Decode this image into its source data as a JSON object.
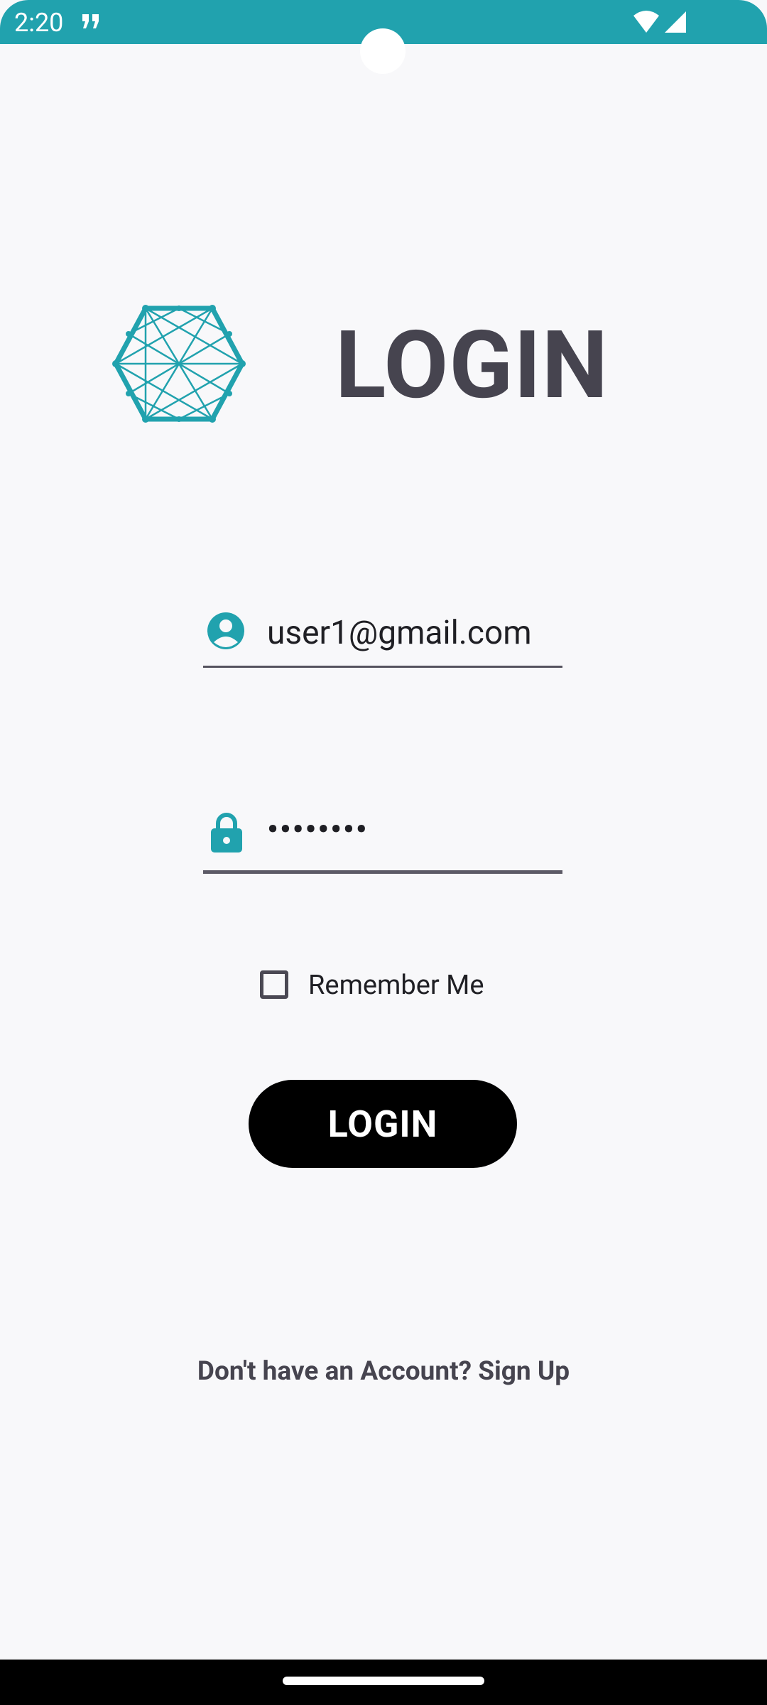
{
  "status_bar": {
    "time": "2:20",
    "color": "#21a2ae",
    "icons": [
      "quote-notification-icon",
      "wifi-icon",
      "signal-icon"
    ]
  },
  "header": {
    "logo_icon": "hexagon-network-logo",
    "title": "LOGIN"
  },
  "form": {
    "email": {
      "icon": "account-circle-icon",
      "value": "user1@gmail.com"
    },
    "password": {
      "icon": "lock-icon",
      "value": "••••••••"
    },
    "remember_me": {
      "label": "Remember Me",
      "checked": false
    },
    "login_button_label": "LOGIN"
  },
  "footer": {
    "signup_text": "Don't have an Account? Sign Up"
  },
  "colors": {
    "accent": "#21a2ae",
    "text_dark": "#46444f",
    "button_bg": "#000000",
    "background": "#f8f8fa"
  }
}
